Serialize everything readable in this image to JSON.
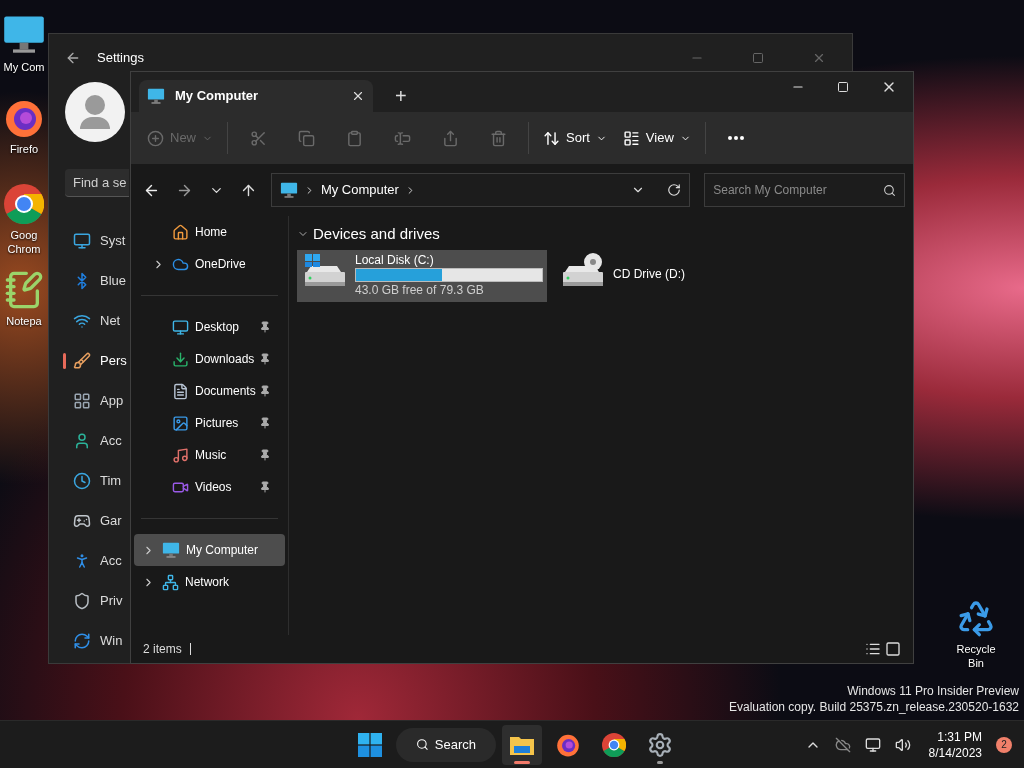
{
  "desktop_icons_left": [
    {
      "kind": "computer",
      "label": "My Com"
    },
    {
      "kind": "firefox",
      "label": "Firefo"
    },
    {
      "kind": "chrome",
      "label": "Goog Chrom"
    },
    {
      "kind": "notepad",
      "label": "Notepa"
    }
  ],
  "desktop_icons_right": [
    {
      "kind": "recycle",
      "label": "Recycle Bin"
    }
  ],
  "settings": {
    "title": "Settings",
    "search_placeholder": "Find a se",
    "nav": [
      {
        "kind": "system",
        "label": "Syst",
        "selected": false
      },
      {
        "kind": "bluetooth",
        "label": "Blue",
        "selected": false
      },
      {
        "kind": "network",
        "label": "Net",
        "selected": false
      },
      {
        "kind": "personalization",
        "label": "Pers",
        "selected": true
      },
      {
        "kind": "apps",
        "label": "App",
        "selected": false
      },
      {
        "kind": "accounts",
        "label": "Acc",
        "selected": false
      },
      {
        "kind": "time",
        "label": "Tim",
        "selected": false
      },
      {
        "kind": "gaming",
        "label": "Gar",
        "selected": false
      },
      {
        "kind": "accessibility",
        "label": "Acc",
        "selected": false
      },
      {
        "kind": "privacy",
        "label": "Priv",
        "selected": false
      },
      {
        "kind": "update",
        "label": "Win",
        "selected": false
      }
    ]
  },
  "explorer": {
    "tab": {
      "title": "My Computer",
      "new_tab": "+"
    },
    "toolbar_groups": [
      [
        {
          "kind": "new",
          "label": "New",
          "disabled": true
        }
      ],
      [
        {
          "kind": "cut",
          "disabled": true
        },
        {
          "kind": "copy",
          "disabled": true
        },
        {
          "kind": "paste",
          "disabled": true
        },
        {
          "kind": "rename",
          "disabled": true
        },
        {
          "kind": "share",
          "disabled": true
        },
        {
          "kind": "delete",
          "disabled": true
        }
      ],
      [
        {
          "kind": "sort",
          "label": "Sort",
          "disabled": false
        },
        {
          "kind": "view",
          "label": "View",
          "disabled": false
        }
      ],
      [
        {
          "kind": "more",
          "disabled": false
        }
      ]
    ],
    "address": {
      "path": "My Computer"
    },
    "search_placeholder": "Search My Computer",
    "nav_sections": [
      [
        {
          "kind": "home",
          "label": "Home",
          "pinned": false,
          "selected": false
        },
        {
          "kind": "onedrive",
          "label": "OneDrive",
          "expanded": false,
          "pinned": false,
          "selected": false
        }
      ],
      [
        {
          "kind": "desktop",
          "label": "Desktop",
          "pinned": true,
          "selected": false
        },
        {
          "kind": "downloads",
          "label": "Downloads",
          "pinned": true,
          "selected": false
        },
        {
          "kind": "documents",
          "label": "Documents",
          "pinned": true,
          "selected": false
        },
        {
          "kind": "pictures",
          "label": "Pictures",
          "pinned": true,
          "selected": false
        },
        {
          "kind": "music",
          "label": "Music",
          "pinned": true,
          "selected": false
        },
        {
          "kind": "videos",
          "label": "Videos",
          "pinned": true,
          "selected": false
        }
      ],
      [
        {
          "kind": "computer",
          "label": "My Computer",
          "expanded": false,
          "pinned": false,
          "selected": true
        },
        {
          "kind": "network",
          "label": "Network",
          "expanded": false,
          "pinned": false,
          "selected": false
        }
      ]
    ],
    "group": {
      "title": "Devices and drives",
      "expanded": true
    },
    "drives": [
      {
        "kind": "disk",
        "name": "Local Disk (C:)",
        "level": 0.46,
        "free": "43.0 GB free of 79.3 GB",
        "selected": true
      },
      {
        "kind": "cd",
        "name": "CD Drive (D:)",
        "selected": false
      }
    ],
    "status": "2 items"
  },
  "watermark": [
    "Windows 11 Pro Insider Preview",
    "Evaluation copy. Build 25375.zn_release.230520-1632"
  ],
  "taskbar": {
    "search": "Search",
    "apps": [
      {
        "kind": "explorer",
        "running": true,
        "active": true
      },
      {
        "kind": "firefox",
        "running": false,
        "active": false
      },
      {
        "kind": "chrome",
        "running": false,
        "active": false
      },
      {
        "kind": "settings",
        "running": true,
        "active": false
      }
    ],
    "time": "1:31 PM",
    "date": "8/14/2023",
    "notifications": "2"
  }
}
